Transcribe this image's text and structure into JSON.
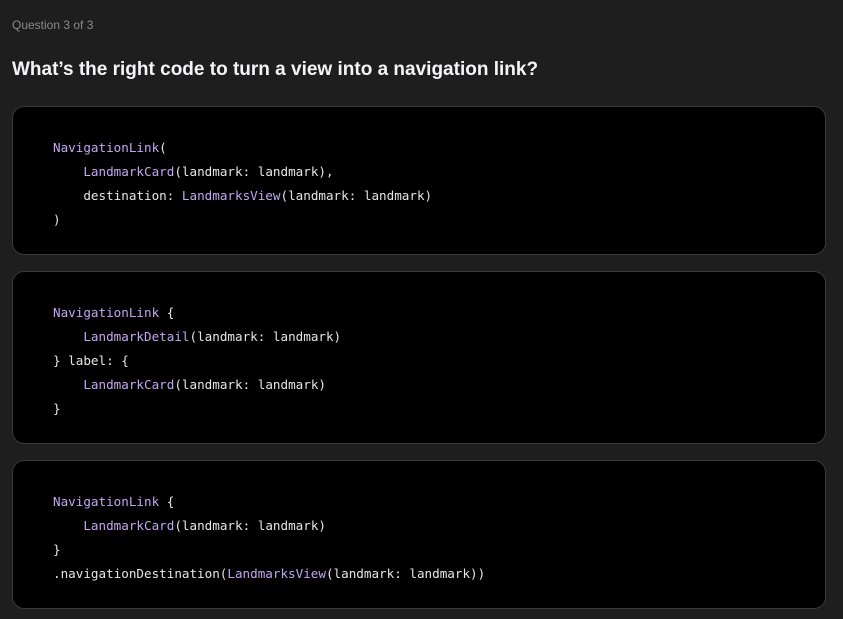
{
  "progress": "Question 3 of 3",
  "question": "What’s the right code to turn a view into a navigation link?",
  "choices": [
    {
      "id": "a",
      "lines": [
        [
          {
            "t": "type",
            "v": "NavigationLink"
          },
          {
            "t": "plain",
            "v": "("
          }
        ],
        [
          {
            "t": "plain",
            "v": "    "
          },
          {
            "t": "type",
            "v": "LandmarkCard"
          },
          {
            "t": "plain",
            "v": "(landmark: landmark),"
          }
        ],
        [
          {
            "t": "plain",
            "v": "    destination: "
          },
          {
            "t": "type",
            "v": "LandmarksView"
          },
          {
            "t": "plain",
            "v": "(landmark: landmark)"
          }
        ],
        [
          {
            "t": "plain",
            "v": ")"
          }
        ]
      ]
    },
    {
      "id": "b",
      "lines": [
        [
          {
            "t": "type",
            "v": "NavigationLink"
          },
          {
            "t": "plain",
            "v": " {"
          }
        ],
        [
          {
            "t": "plain",
            "v": "    "
          },
          {
            "t": "type",
            "v": "LandmarkDetail"
          },
          {
            "t": "plain",
            "v": "(landmark: landmark)"
          }
        ],
        [
          {
            "t": "plain",
            "v": "} label: {"
          }
        ],
        [
          {
            "t": "plain",
            "v": "    "
          },
          {
            "t": "type",
            "v": "LandmarkCard"
          },
          {
            "t": "plain",
            "v": "(landmark: landmark)"
          }
        ],
        [
          {
            "t": "plain",
            "v": "}"
          }
        ]
      ]
    },
    {
      "id": "c",
      "lines": [
        [
          {
            "t": "type",
            "v": "NavigationLink"
          },
          {
            "t": "plain",
            "v": " {"
          }
        ],
        [
          {
            "t": "plain",
            "v": "    "
          },
          {
            "t": "type",
            "v": "LandmarkCard"
          },
          {
            "t": "plain",
            "v": "(landmark: landmark)"
          }
        ],
        [
          {
            "t": "plain",
            "v": "}"
          }
        ],
        [
          {
            "t": "plain",
            "v": ".navigationDestination("
          },
          {
            "t": "type",
            "v": "LandmarksView"
          },
          {
            "t": "plain",
            "v": "(landmark: landmark))"
          }
        ]
      ]
    }
  ],
  "colors": {
    "background": "#1e1e1e",
    "card": "#000000",
    "card_border": "#3a3a3c",
    "type_token": "#c3a6f2",
    "plain_token": "#e6e6e6",
    "muted_text": "#8a8a8e"
  }
}
